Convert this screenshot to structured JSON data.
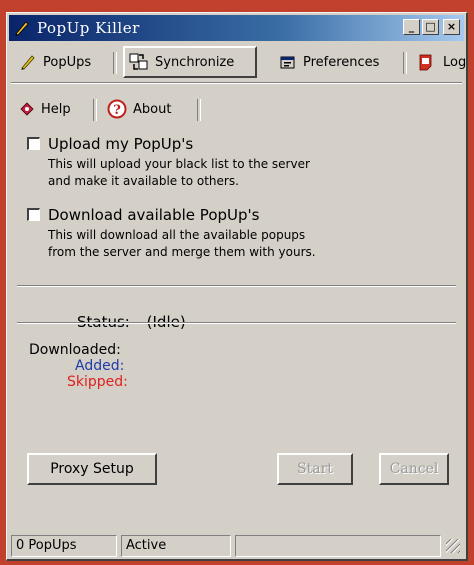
{
  "window": {
    "title": "PopUp Killer",
    "controls": {
      "minimize": "_",
      "maximize": "□",
      "close": "×"
    }
  },
  "tabs": [
    {
      "label": "PopUps",
      "icon": "pencil-icon"
    },
    {
      "label": "Synchronize",
      "icon": "sync-icon",
      "selected": true
    },
    {
      "label": "Preferences",
      "icon": "preferences-icon"
    },
    {
      "label": "Log",
      "icon": "log-icon"
    },
    {
      "label": "Help",
      "icon": "help-icon"
    },
    {
      "label": "About",
      "icon": "about-icon"
    }
  ],
  "upload": {
    "label": "Upload my PopUp's",
    "checked": false,
    "description_line1": "This will upload your black list to the server",
    "description_line2": "and make it available to others."
  },
  "download": {
    "label": "Download available PopUp's",
    "checked": false,
    "description_line1": "This will download all the available popups",
    "description_line2": "from the server and merge them with yours."
  },
  "status": {
    "label": "Status:",
    "value": "(Idle)"
  },
  "results": {
    "downloaded": "Downloaded:",
    "added": "Added:",
    "skipped": "Skipped:",
    "added_color": "#1f3aa8",
    "skipped_color": "#e02020"
  },
  "buttons": {
    "proxy_setup": "Proxy Setup",
    "start": "Start",
    "cancel": "Cancel"
  },
  "statusbar": {
    "count": "0 PopUps",
    "state": "Active"
  }
}
